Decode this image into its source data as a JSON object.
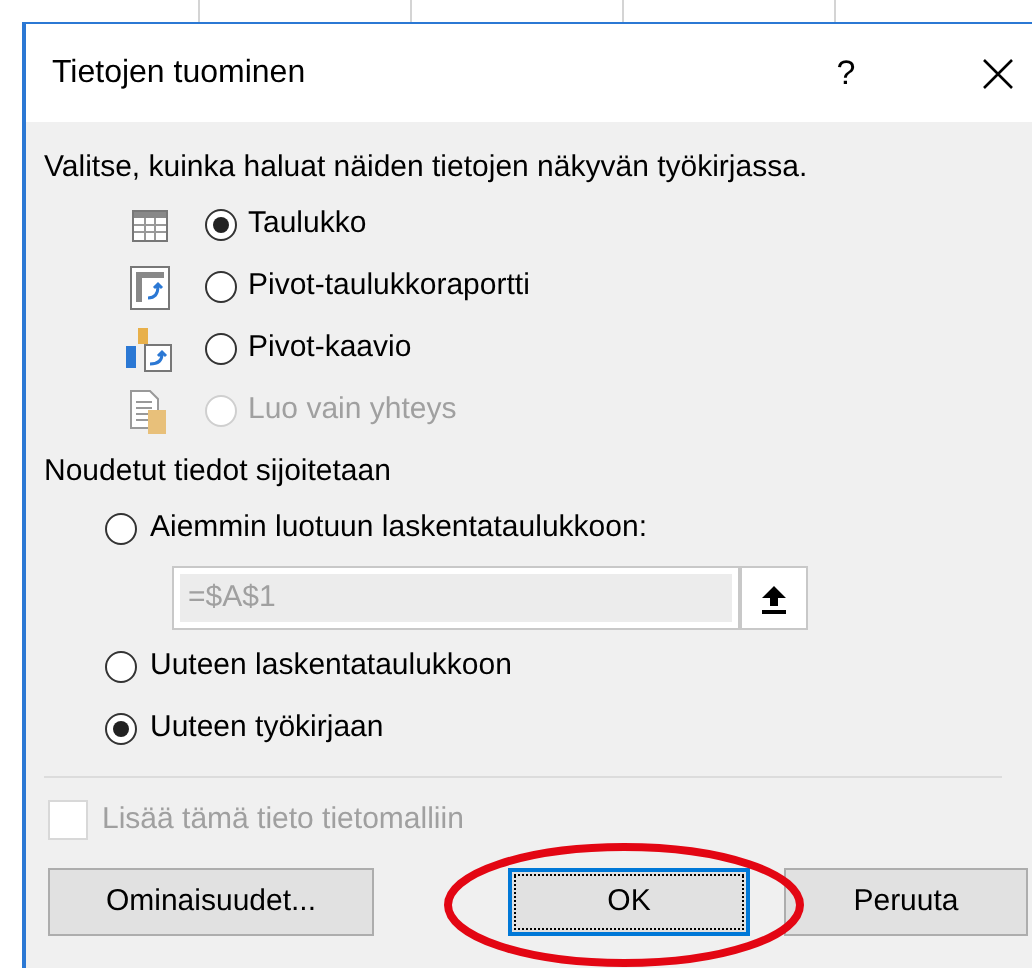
{
  "window": {
    "title": "Tietojen tuominen",
    "help": "?"
  },
  "instruction": "Valitse, kuinka haluat näiden tietojen näkyvän työkirjassa.",
  "view_options": [
    {
      "kind": "table",
      "label": "Taulukko",
      "selected": true,
      "disabled": false
    },
    {
      "kind": "pivot-table",
      "label": "Pivot-taulukkoraportti",
      "selected": false,
      "disabled": false
    },
    {
      "kind": "pivot-chart",
      "label": "Pivot-kaavio",
      "selected": false,
      "disabled": false
    },
    {
      "kind": "connection",
      "label": "Luo vain yhteys",
      "selected": false,
      "disabled": true
    }
  ],
  "destination_heading": "Noudetut tiedot sijoitetaan",
  "destination_options": [
    {
      "kind": "existing",
      "label": "Aiemmin luotuun laskentataulukkoon:",
      "selected": false
    },
    {
      "kind": "new-sheet",
      "label": "Uuteen laskentataulukkoon",
      "selected": false
    },
    {
      "kind": "new-workbook",
      "label": "Uuteen työkirjaan",
      "selected": true
    }
  ],
  "range_field": {
    "value": "=$A$1",
    "disabled": true
  },
  "data_model": {
    "label": "Lisää tämä tieto tietomalliin",
    "checked": false,
    "disabled": true
  },
  "buttons": [
    {
      "label": "Ominaisuudet...",
      "default": false
    },
    {
      "label": "OK",
      "default": true
    },
    {
      "label": "Peruuta",
      "default": false
    }
  ]
}
